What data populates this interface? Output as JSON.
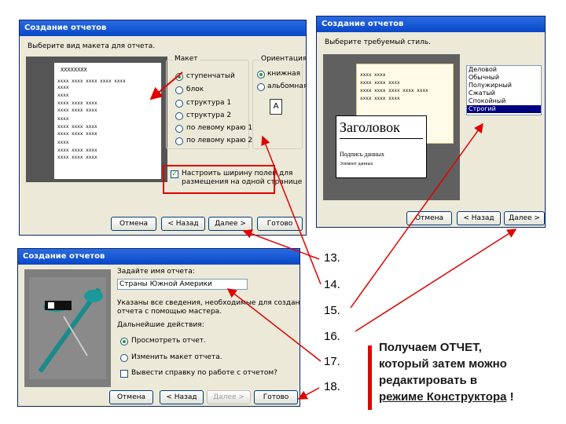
{
  "win1": {
    "title": "Создание отчетов",
    "prompt": "Выберите вид макета для отчета.",
    "preview_header": "XXXXXXXX",
    "preview_rows": [
      "xxxx xxxx xxxx xxxx xxxx",
      "xxxx",
      "    xxxx",
      "        xxxx xxxx xxxx",
      "        xxxx xxxx xxxx",
      "xxxx",
      "        xxxx xxxx xxxx",
      "        xxxx xxxx xxxx",
      "xxxx",
      "        xxxx xxxx xxxx",
      "        xxxx xxxx xxxx"
    ],
    "layout_group": "Макет",
    "layout_options": [
      "ступенчатый",
      "блок",
      "структура 1",
      "структура 2",
      "по левому краю 1",
      "по левому краю 2"
    ],
    "orient_group": "Ориентация",
    "orient_options": [
      "книжная",
      "альбомная"
    ],
    "orient_icon_letter": "A",
    "checkbox_label_1": "Настроить ширину полей для",
    "checkbox_label_2": "размещения на одной странице",
    "btn_cancel": "Отмена",
    "btn_back": "< Назад",
    "btn_next": "Далее >",
    "btn_finish": "Готово"
  },
  "win2": {
    "title": "Создание отчетов",
    "prompt": "Выберите требуемый стиль.",
    "preview_rows": [
      "xxxx xxxx",
      "xxxx xxxx xxxx",
      "xxxx xxxx xxxx xxxx xxxx",
      "xxxx xxxx xxxx"
    ],
    "preview_heading": "Заголовок",
    "preview_sub": "Подпись данных",
    "preview_small": "Элемент данных",
    "styles": [
      "Деловой",
      "Обычный",
      "Полужирный",
      "Сжатый",
      "Спокойный",
      "Строгий"
    ],
    "selected_style": "Строгий",
    "btn_cancel": "Отмена",
    "btn_back": "< Назад",
    "btn_next": "Далее >"
  },
  "win3": {
    "title": "Создание отчетов",
    "prompt": "Задайте имя отчета:",
    "report_name": "Страны Южной Америки",
    "info_1": "Указаны все сведения, необходимые для создания",
    "info_2": "отчета с помощью мастера.",
    "next_action": "Дальнейшие действия:",
    "opt_view": "Просмотреть отчет.",
    "opt_edit": "Изменить макет отчета.",
    "help_label": "Вывести справку по работе с отчетом?",
    "btn_cancel": "Отмена",
    "btn_back": "< Назад",
    "btn_next": "Далее >",
    "btn_finish": "Готово"
  },
  "steps": [
    "13.",
    "14.",
    "15.",
    "16.",
    "17.",
    "18."
  ],
  "note": {
    "line1": "Получаем ОТЧЕТ,",
    "line2": "который затем можно",
    "line3": "редактировать в",
    "line4": "режиме Конструктора",
    "line4_end": " !"
  },
  "colors": {
    "accent_red": "#e00000",
    "title_blue": "#0a48c8",
    "selection": "#000080"
  }
}
